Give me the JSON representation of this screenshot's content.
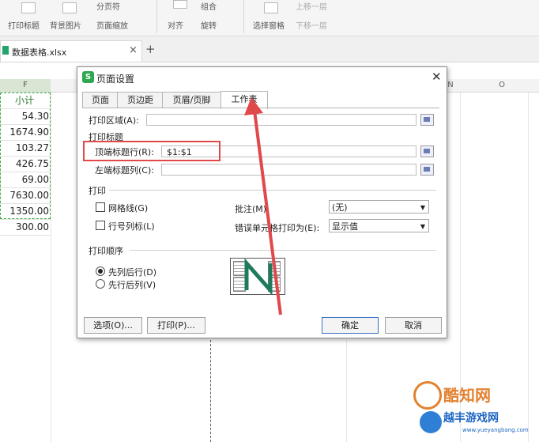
{
  "ribbon": {
    "buttons": [
      "打印标题",
      "背景图片",
      "分页符",
      "页面缩放",
      "对齐",
      "旋转",
      "组合",
      "选择窗格",
      "上移一层",
      "下移一层"
    ]
  },
  "file_tab": {
    "name": "数据表格.xlsx",
    "close": "×",
    "add": "+"
  },
  "sheet": {
    "col_f": "F",
    "col_n": "N",
    "col_o": "O",
    "cells": [
      "小计",
      "54.30",
      "1674.90",
      "103.27",
      "426.75",
      "69.00",
      "7630.00",
      "1350.00",
      "300.00"
    ]
  },
  "dialog": {
    "logo": "S",
    "title": "页面设置",
    "close": "✕",
    "tabs": [
      "页面",
      "页边距",
      "页眉/页脚",
      "工作表"
    ],
    "print_area_label": "打印区域(A):",
    "print_area_value": "",
    "print_titles_group": "打印标题",
    "top_rows_label": "顶端标题行(R):",
    "top_rows_value": "$1:$1",
    "left_cols_label": "左端标题列(C):",
    "left_cols_value": "",
    "print_group": "打印",
    "gridlines_label": "网格线(G)",
    "rowcol_label": "行号列标(L)",
    "comments_label": "批注(M):",
    "comments_value": "(无)",
    "errors_label": "错误单元格打印为(E):",
    "errors_value": "显示值",
    "order_group": "打印顺序",
    "order_down_then_over": "先列后行(D)",
    "order_over_then_down": "先行后列(V)",
    "options_button": "选项(O)...",
    "print_button": "打印(P)...",
    "ok_button": "确定",
    "cancel_button": "取消"
  },
  "watermark": {
    "line1": "酷知网",
    "line2": "越丰游戏网",
    "url": "www.yueyangbang.com"
  },
  "colors": {
    "highlight": "#e0484a",
    "arrow": "#e0484a",
    "selection": "#3cae3c",
    "logo": "#2fa84f"
  }
}
